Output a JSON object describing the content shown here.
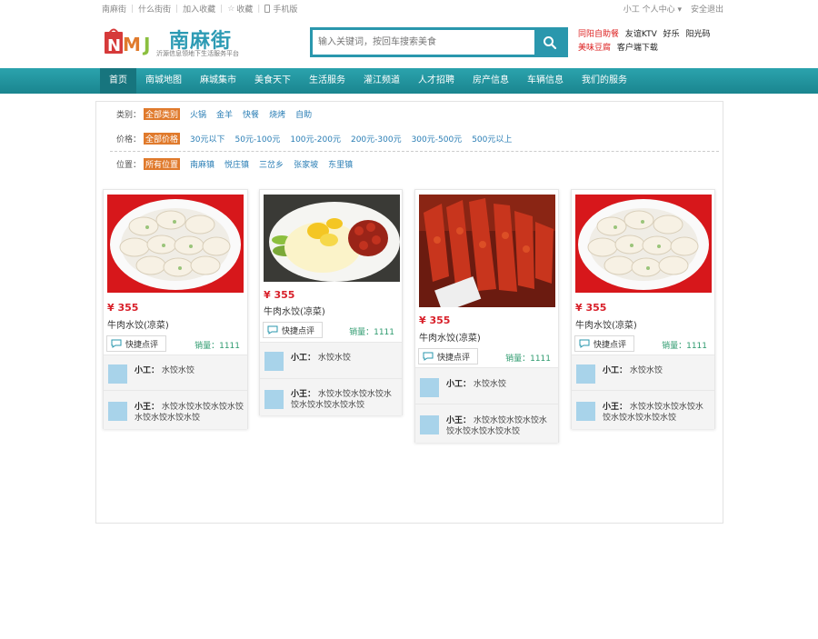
{
  "topbar": {
    "links": [
      "南麻街",
      "什么街街",
      "加入收藏"
    ],
    "favorite": "收藏",
    "mobile": "手机版",
    "user": "小工 个人中心",
    "logout": "安全退出"
  },
  "header": {
    "logo_letters": "NMJ",
    "logo_name": "南麻街",
    "logo_slogan": "沂源信息领地下生活服务平台",
    "search_placeholder": "输入关键词，按回车搜索美食",
    "hotlinks_row1": [
      "同阳自助餐",
      "友谊KTV",
      "好乐",
      "阳光码"
    ],
    "hotlinks_row2": [
      "美味豆腐",
      "客户端下载"
    ]
  },
  "nav": {
    "items": [
      "首页",
      "南城地图",
      "麻城集市",
      "美食天下",
      "生活服务",
      "灌江频道",
      "人才招聘",
      "房产信息",
      "车辆信息",
      "我们的服务"
    ],
    "active_index": 0
  },
  "filters": {
    "category": {
      "label": "类别：",
      "options": [
        "全部类别",
        "火锅",
        "金羊",
        "快餐",
        "烧烤",
        "自助"
      ]
    },
    "price": {
      "label": "价格：",
      "options": [
        "全部价格",
        "30元以下",
        "50元-100元",
        "100元-200元",
        "200元-300元",
        "300元-500元",
        "500元以上"
      ]
    },
    "location": {
      "label": "位置：",
      "options": [
        "所有位置",
        "南麻镇",
        "悦庄镇",
        "三岔乡",
        "张家坡",
        "东里镇"
      ]
    }
  },
  "cards": [
    {
      "image": "dumplings-icon",
      "price": "¥ 355",
      "title": "牛肉水饺(凉菜)",
      "chat_label": "快捷点评",
      "sales": "销量：1111",
      "comments": [
        {
          "user": "小工：",
          "text": "水饺水饺"
        },
        {
          "user": "小王：",
          "text": "水饺水饺水饺水饺水饺水饺水饺水饺水饺"
        }
      ]
    },
    {
      "image": "dessert-plate-icon",
      "price": "¥ 355",
      "title": "牛肉水饺(凉菜)",
      "chat_label": "快捷点评",
      "sales": "销量：1111",
      "comments": [
        {
          "user": "小工：",
          "text": "水饺水饺"
        },
        {
          "user": "小王：",
          "text": "水饺水饺水饺水饺水饺水饺水饺水饺水饺"
        }
      ]
    },
    {
      "image": "grilled-meat-icon",
      "price": "¥ 355",
      "title": "牛肉水饺(凉菜)",
      "chat_label": "快捷点评",
      "sales": "销量：1111",
      "comments": [
        {
          "user": "小工：",
          "text": "水饺水饺"
        },
        {
          "user": "小王：",
          "text": "水饺水饺水饺水饺水饺水饺水饺水饺水饺"
        }
      ]
    },
    {
      "image": "dumplings-icon",
      "price": "¥ 355",
      "title": "牛肉水饺(凉菜)",
      "chat_label": "快捷点评",
      "sales": "销量：1111",
      "comments": [
        {
          "user": "小工：",
          "text": "水饺水饺"
        },
        {
          "user": "小王：",
          "text": "水饺水饺水饺水饺水饺水饺水饺水饺水饺"
        }
      ]
    }
  ],
  "colors": {
    "brand": "#2a97ad",
    "accent": "#e07a2c",
    "price": "#d8202a"
  }
}
